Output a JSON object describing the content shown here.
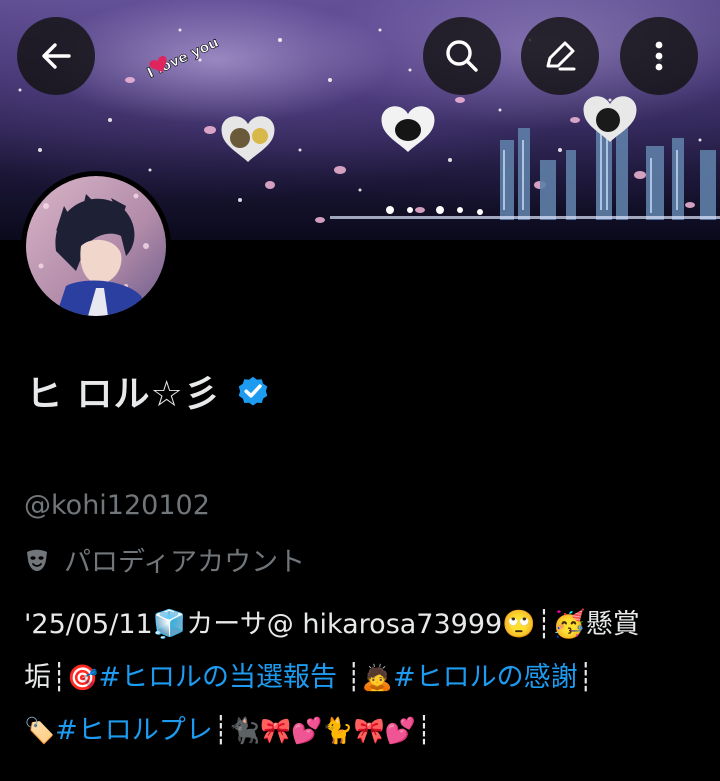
{
  "header": {
    "back_icon": "arrow-left-icon",
    "search_icon": "search-icon",
    "edit_icon": "pencil-icon",
    "more_icon": "more-vertical-icon",
    "banner_text": "I love you"
  },
  "profile": {
    "display_name": "ヒ ロル☆彡",
    "verified_color": "#1d9bf0",
    "handle": "@kohi120102",
    "account_label": "パロディアカウント",
    "account_label_icon": "theater-mask-icon"
  },
  "bio": {
    "line1": {
      "part1": "'25/05/11🧊カーサ@ hikarosa73999🙄",
      "sep1": "┊",
      "part2": "🥳懸賞"
    },
    "line2": {
      "part1": "垢",
      "sep1": "┊",
      "emoji1": "🎯",
      "tag1": "#ヒロルの当選報告",
      "sep2": "┊",
      "emoji2": "🙇",
      "tag2": "#ヒロルの感謝",
      "sep3": "┊"
    },
    "line3": {
      "emoji1": "🏷️",
      "tag1": "#ヒロルプレ",
      "sep1": "┊",
      "emoji2": "🐈‍⬛🎀💕🐈🎀💕",
      "sep2": "┊"
    }
  },
  "colors": {
    "background": "#000000",
    "link": "#1d9bf0",
    "muted": "#71767b",
    "text": "#e7e9ea"
  }
}
